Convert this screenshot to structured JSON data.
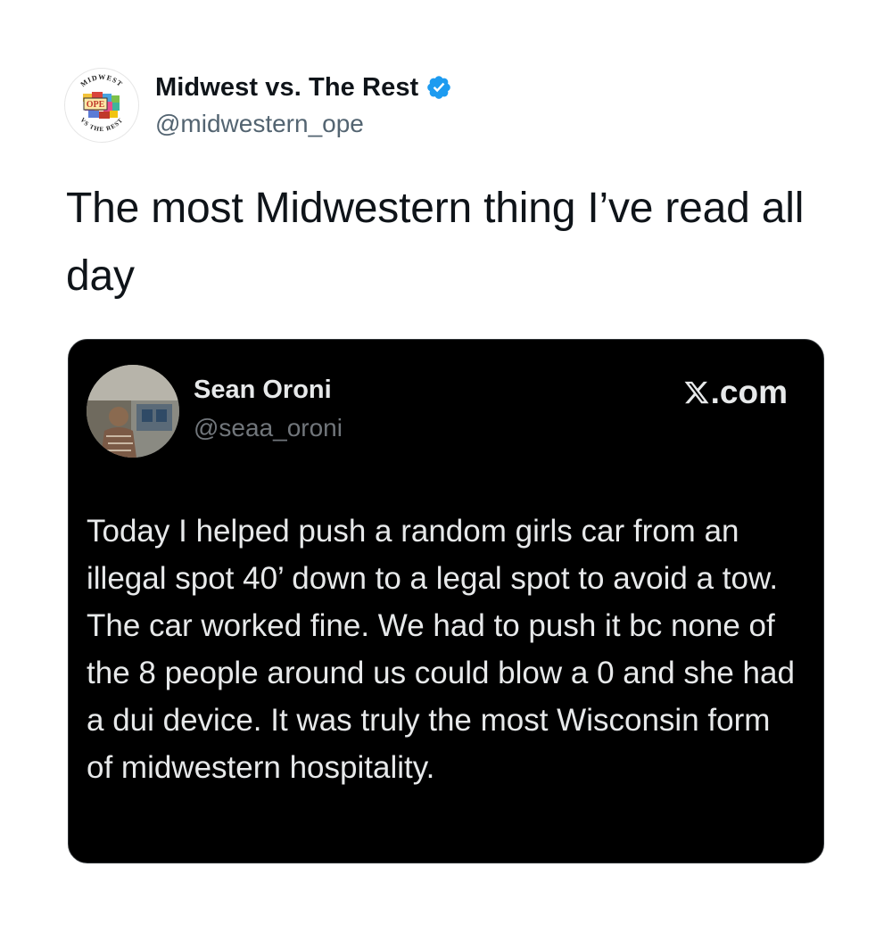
{
  "tweet": {
    "author": {
      "display_name": "Midwest vs. The Rest",
      "handle": "@midwestern_ope",
      "verified": true,
      "avatar_text": {
        "top_arc": "MIDWEST",
        "bottom_arc": "VS THE REST",
        "center": "OPE"
      }
    },
    "text": "The most Midwestern thing I’ve read all day",
    "quoted": {
      "display_name": "Sean Oroni",
      "handle": "@seaa_oroni",
      "site_label": ".com",
      "body": "Today I helped push a random girls car from an illegal spot 40’ down to a legal spot to avoid a tow. The car worked fine. We had to push it bc none of the 8 people around us could blow a 0 and she had a dui device. It was truly the most Wisconsin form of midwestern hospitality."
    }
  },
  "colors": {
    "verified_blue": "#1d9bf0",
    "card_background": "#000000",
    "card_text": "#e7e9ea",
    "handle_gray": "#536471"
  }
}
